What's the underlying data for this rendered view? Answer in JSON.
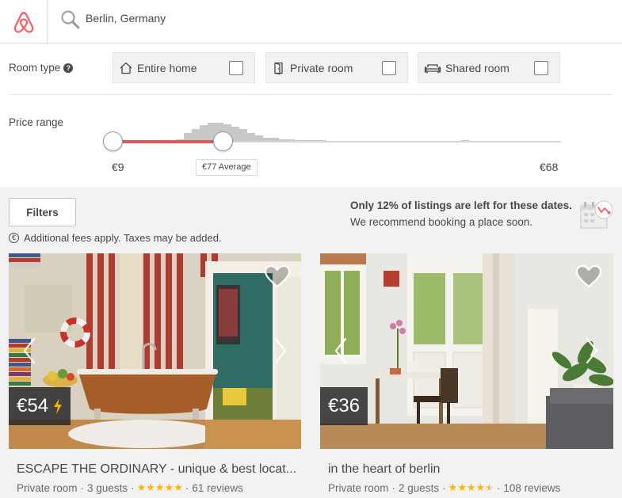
{
  "header": {
    "logo_icon": "airbnb-logo-icon",
    "search_icon": "search-icon",
    "search_value": "Berlin, Germany"
  },
  "room_type": {
    "label": "Room type",
    "help": "?",
    "options": [
      {
        "label": "Entire home",
        "icon": "house-icon",
        "checked": false
      },
      {
        "label": "Private room",
        "icon": "door-icon",
        "checked": false
      },
      {
        "label": "Shared room",
        "icon": "couch-icon",
        "checked": false
      }
    ]
  },
  "price_range": {
    "label": "Price range",
    "min_label": "€9",
    "max_label": "€68",
    "average_label": "€77 Average"
  },
  "filters": {
    "button_label": "Filters",
    "fees_icon": "€",
    "fees_text": "Additional fees apply. Taxes may be added."
  },
  "notice": {
    "strong": "Only 12% of listings are left for these dates.",
    "sub": "We recommend booking a place soon.",
    "icon": "calendar-clock-icon"
  },
  "listings": [
    {
      "price": "€54",
      "instant_book": true,
      "title": "ESCAPE THE ORDINARY - unique & best locat...",
      "room_type": "Private room",
      "guests": "3 guests",
      "stars": "★★★★★",
      "rating": 5,
      "reviews": "61 reviews",
      "sep": "·"
    },
    {
      "price": "€36",
      "instant_book": false,
      "title": "in the heart of berlin",
      "room_type": "Private room",
      "guests": "2 guests",
      "stars": "★★★★★",
      "rating": 4.5,
      "reviews": "108 reviews",
      "sep": "·"
    }
  ],
  "colors": {
    "brand": "#ff5a5f",
    "slider_fill": "#e05a5a",
    "star": "#ffb400",
    "lightning": "#ffb400"
  }
}
